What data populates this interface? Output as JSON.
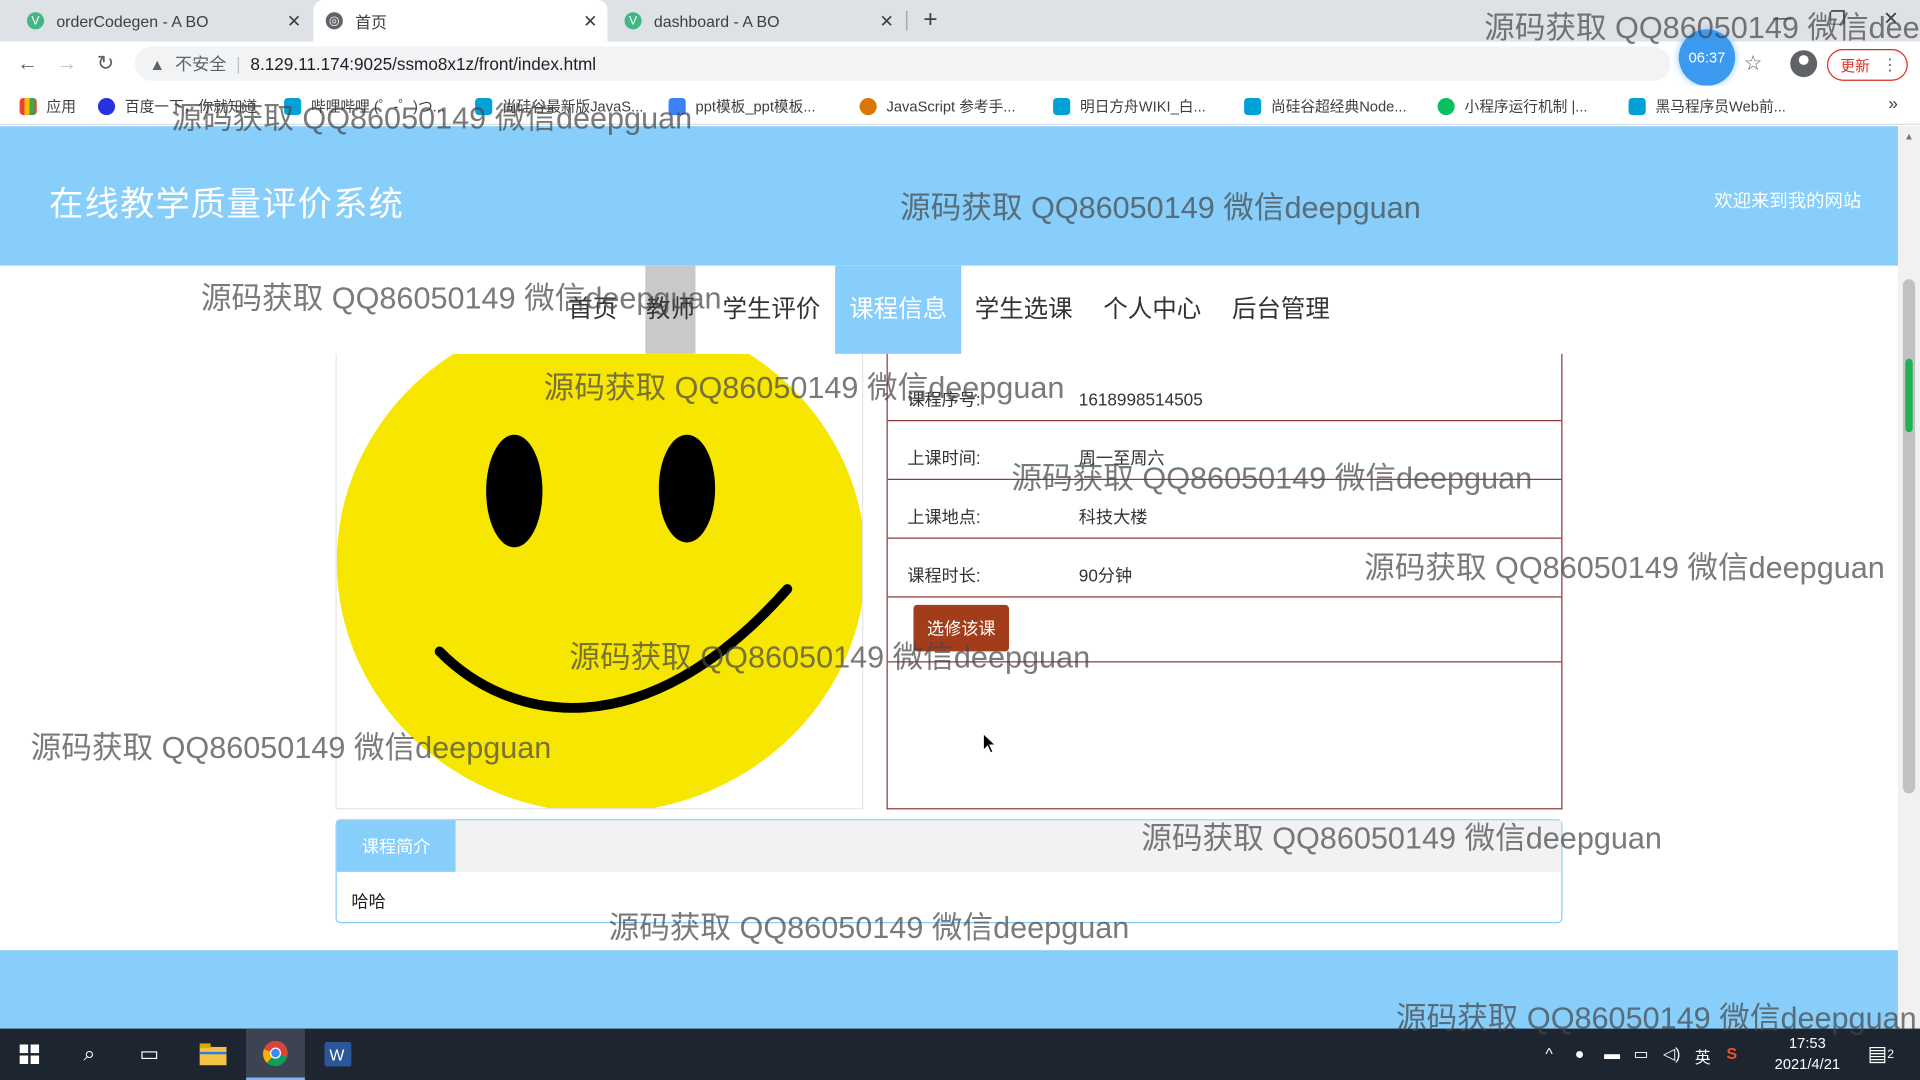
{
  "tabs": [
    {
      "title": "orderCodegen - A BO",
      "favicon": "vue-icon"
    },
    {
      "title": "首页",
      "favicon": "globe-icon"
    },
    {
      "title": "dashboard - A BO",
      "favicon": "vue-icon"
    }
  ],
  "address": {
    "security": "不安全",
    "url": "8.129.11.174:9025/ssmo8x1z/front/index.html"
  },
  "timer": "06:37",
  "update_label": "更新",
  "bookmarks": [
    "应用",
    "百度一下，你就知道",
    "哔哩哔哩 (゜-゜)つ...",
    "尚硅谷最新版JavaS...",
    "ppt模板_ppt模板...",
    "JavaScript 参考手...",
    "明日方舟WIKI_白...",
    "尚硅谷超经典Node...",
    "小程序运行机制 |...",
    "黑马程序员Web前..."
  ],
  "header": {
    "title": "在线教学质量评价系统",
    "welcome": "欢迎来到我的网站"
  },
  "nav": [
    "首页",
    "教师",
    "学生评价",
    "课程信息",
    "学生选课",
    "个人中心",
    "后台管理"
  ],
  "course": {
    "fields": [
      {
        "label": "课程序号:",
        "value": "1618998514505"
      },
      {
        "label": "上课时间:",
        "value": "周一至周六"
      },
      {
        "label": "上课地点:",
        "value": "科技大楼"
      },
      {
        "label": "课程时长:",
        "value": "90分钟"
      }
    ],
    "enroll_button": "选修该课",
    "intro_tab": "课程简介",
    "intro_text": "哈哈"
  },
  "watermark": "源码获取 QQ86050149 微信deepguan",
  "taskbar": {
    "ime": "英",
    "time": "17:53",
    "date": "2021/4/21",
    "notifications": "2"
  },
  "colors": {
    "header_bg": "#87cefa",
    "enroll_button": "#a33c1a",
    "info_border": "#8b3a3a",
    "smiley_yellow": "#f7e600"
  }
}
